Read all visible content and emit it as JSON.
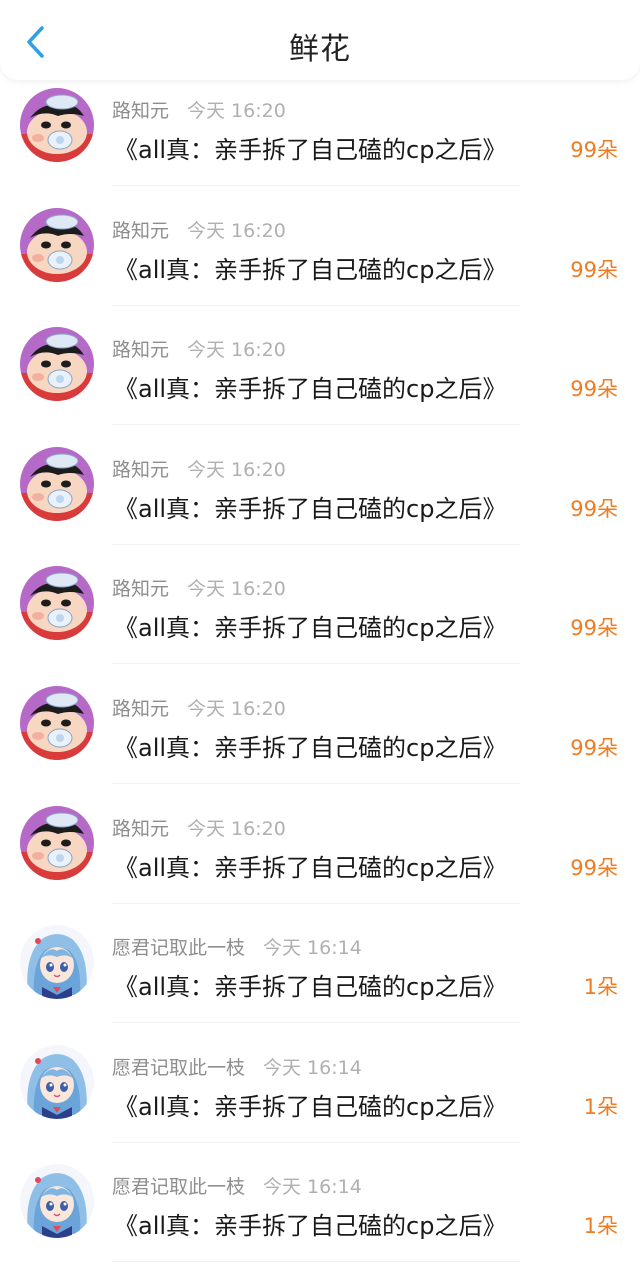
{
  "header": {
    "title": "鲜花",
    "back_icon": "chevron-left-icon",
    "accent_color": "#2ea0e6"
  },
  "colors": {
    "amount": "#f07c22",
    "name": "#8e8e8e",
    "time": "#b0b0b0",
    "title": "#1a1a1a"
  },
  "items": [
    {
      "name": "路知元",
      "time": "今天 16:20",
      "title": "《all真：亲手拆了自己磕的cp之后》",
      "amount": "99朵",
      "avatar": "crayon-shin-chan-avatar"
    },
    {
      "name": "路知元",
      "time": "今天 16:20",
      "title": "《all真：亲手拆了自己磕的cp之后》",
      "amount": "99朵",
      "avatar": "crayon-shin-chan-avatar"
    },
    {
      "name": "路知元",
      "time": "今天 16:20",
      "title": "《all真：亲手拆了自己磕的cp之后》",
      "amount": "99朵",
      "avatar": "crayon-shin-chan-avatar"
    },
    {
      "name": "路知元",
      "time": "今天 16:20",
      "title": "《all真：亲手拆了自己磕的cp之后》",
      "amount": "99朵",
      "avatar": "crayon-shin-chan-avatar"
    },
    {
      "name": "路知元",
      "time": "今天 16:20",
      "title": "《all真：亲手拆了自己磕的cp之后》",
      "amount": "99朵",
      "avatar": "crayon-shin-chan-avatar"
    },
    {
      "name": "路知元",
      "time": "今天 16:20",
      "title": "《all真：亲手拆了自己磕的cp之后》",
      "amount": "99朵",
      "avatar": "crayon-shin-chan-avatar"
    },
    {
      "name": "路知元",
      "time": "今天 16:20",
      "title": "《all真：亲手拆了自己磕的cp之后》",
      "amount": "99朵",
      "avatar": "crayon-shin-chan-avatar"
    },
    {
      "name": "愿君记取此一枝",
      "time": "今天 16:14",
      "title": "《all真：亲手拆了自己磕的cp之后》",
      "amount": "1朵",
      "avatar": "anime-girl-avatar"
    },
    {
      "name": "愿君记取此一枝",
      "time": "今天 16:14",
      "title": "《all真：亲手拆了自己磕的cp之后》",
      "amount": "1朵",
      "avatar": "anime-girl-avatar"
    },
    {
      "name": "愿君记取此一枝",
      "time": "今天 16:14",
      "title": "《all真：亲手拆了自己磕的cp之后》",
      "amount": "1朵",
      "avatar": "anime-girl-avatar"
    }
  ]
}
